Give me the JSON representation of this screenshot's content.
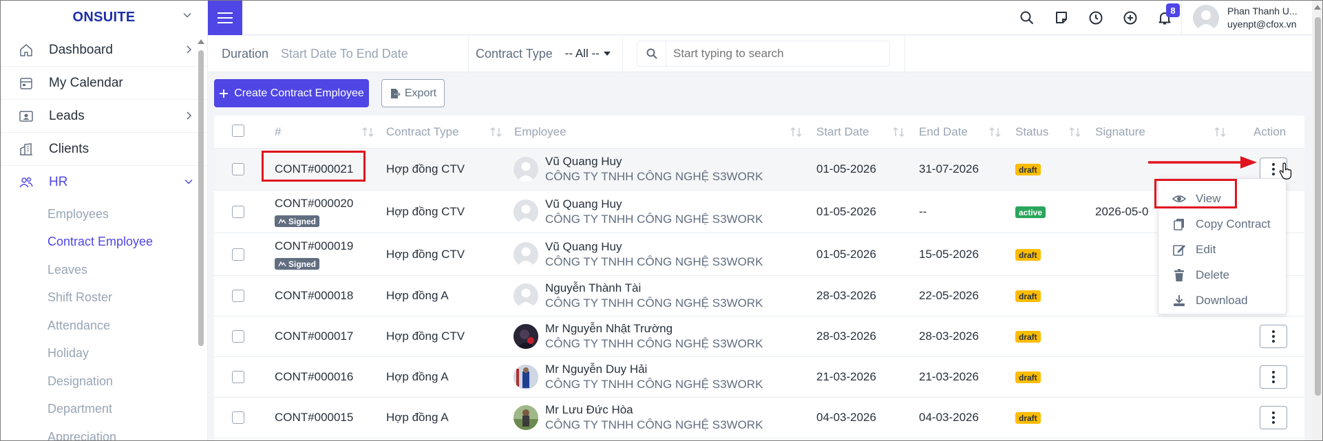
{
  "app": {
    "brand": "ONSUITE"
  },
  "sidebar": {
    "items": [
      {
        "label": "Dashboard",
        "icon": "house-icon",
        "has_arrow": true
      },
      {
        "label": "My Calendar",
        "icon": "calendar-icon",
        "has_arrow": false
      },
      {
        "label": "Leads",
        "icon": "id-card-icon",
        "has_arrow": true
      },
      {
        "label": "Clients",
        "icon": "building-icon",
        "has_arrow": false
      },
      {
        "label": "HR",
        "icon": "users-icon",
        "expanded": true
      }
    ],
    "sub_items": [
      "Employees",
      "Contract Employee",
      "Leaves",
      "Shift Roster",
      "Attendance",
      "Holiday",
      "Designation",
      "Department",
      "Appreciation"
    ],
    "active_sub_item": "Contract Employee"
  },
  "topbar": {
    "notification_count": "8",
    "user_name": "Phan Thanh U...",
    "user_email": "uyenpt@cfox.vn"
  },
  "filters": {
    "duration_label": "Duration",
    "duration_value": "Start Date To End Date",
    "contract_type_label": "Contract Type",
    "contract_type_value": "-- All --",
    "search_placeholder": "Start typing to search"
  },
  "actions": {
    "create_label": "Create Contract Employee",
    "export_label": "Export"
  },
  "table": {
    "columns": [
      "#",
      "Contract Type",
      "Employee",
      "Start Date",
      "End Date",
      "Status",
      "Signature",
      "Action"
    ],
    "rows": [
      {
        "id": "CONT#000021",
        "signed": false,
        "type": "Hợp đồng CTV",
        "employee": "Vũ Quang Huy",
        "company": "CÔNG TY TNHH CÔNG NGHỆ S3WORK",
        "start": "01-05-2026",
        "end": "31-07-2026",
        "status": "draft",
        "signature": ""
      },
      {
        "id": "CONT#000020",
        "signed": true,
        "type": "Hợp đồng CTV",
        "employee": "Vũ Quang Huy",
        "company": "CÔNG TY TNHH CÔNG NGHỆ S3WORK",
        "start": "01-05-2026",
        "end": "--",
        "status": "active",
        "signature": "2026-05-0"
      },
      {
        "id": "CONT#000019",
        "signed": true,
        "type": "Hợp đồng CTV",
        "employee": "Vũ Quang Huy",
        "company": "CÔNG TY TNHH CÔNG NGHỆ S3WORK",
        "start": "01-05-2026",
        "end": "15-05-2026",
        "status": "draft",
        "signature": ""
      },
      {
        "id": "CONT#000018",
        "signed": false,
        "type": "Hợp đồng A",
        "employee": "Nguyễn Thành Tài",
        "company": "CÔNG TY TNHH CÔNG NGHỆ S3WORK",
        "start": "28-03-2026",
        "end": "22-05-2026",
        "status": "draft",
        "signature": ""
      },
      {
        "id": "CONT#000017",
        "signed": false,
        "type": "Hợp đồng CTV",
        "employee": "Mr Nguyễn Nhật Trường",
        "company": "CÔNG TY TNHH CÔNG NGHỆ S3WORK",
        "start": "28-03-2026",
        "end": "28-03-2026",
        "status": "draft",
        "signature": ""
      },
      {
        "id": "CONT#000016",
        "signed": false,
        "type": "Hợp đồng A",
        "employee": "Mr Nguyễn Duy Hải",
        "company": "CÔNG TY TNHH CÔNG NGHỆ S3WORK",
        "start": "21-03-2026",
        "end": "21-03-2026",
        "status": "draft",
        "signature": ""
      },
      {
        "id": "CONT#000015",
        "signed": false,
        "type": "Hợp đồng A",
        "employee": "Mr Lưu Đức Hòa",
        "company": "CÔNG TY TNHH CÔNG NGHỆ S3WORK",
        "start": "04-03-2026",
        "end": "04-03-2026",
        "status": "draft",
        "signature": ""
      }
    ],
    "signed_label": "Signed"
  },
  "dropdown": {
    "items": [
      {
        "label": "View",
        "icon": "eye-icon"
      },
      {
        "label": "Copy Contract",
        "icon": "copy-icon"
      },
      {
        "label": "Edit",
        "icon": "edit-icon"
      },
      {
        "label": "Delete",
        "icon": "trash-icon"
      },
      {
        "label": "Download",
        "icon": "download-icon"
      }
    ]
  },
  "colors": {
    "primary": "#4f46e5",
    "annotation_red": "#e0141e",
    "draft_badge": "#fcbd01",
    "active_badge": "#2ba55c"
  }
}
